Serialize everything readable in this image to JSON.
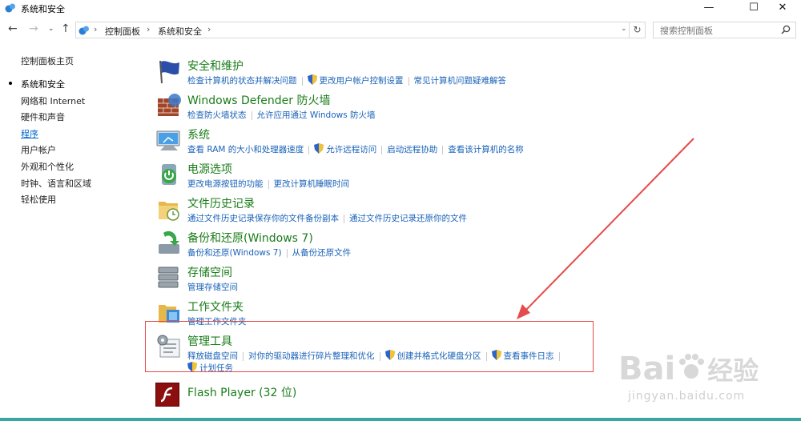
{
  "window": {
    "title": "系统和安全",
    "min": "—",
    "max": "☐",
    "close": "✕"
  },
  "address": {
    "crumbs": [
      "控制面板",
      "系统和安全"
    ],
    "search_placeholder": "搜索控制面板"
  },
  "nav": {
    "items": [
      {
        "label": "控制面板主页"
      },
      {
        "label": "系统和安全"
      },
      {
        "label": "网络和 Internet"
      },
      {
        "label": "硬件和声音"
      },
      {
        "label": "程序"
      },
      {
        "label": "用户帐户"
      },
      {
        "label": "外观和个性化"
      },
      {
        "label": "时钟、语言和区域"
      },
      {
        "label": "轻松使用"
      }
    ]
  },
  "categories": [
    {
      "title": "安全和维护",
      "icon": "flag-icon",
      "links": [
        "检查计算机的状态并解决问题",
        "更改用户帐户控制设置",
        "常见计算机问题疑难解答"
      ]
    },
    {
      "title": "Windows Defender 防火墙",
      "icon": "firewall-icon",
      "links": [
        "检查防火墙状态",
        "允许应用通过 Windows 防火墙"
      ]
    },
    {
      "title": "系统",
      "icon": "system-icon",
      "links": [
        "查看 RAM 的大小和处理器速度",
        "允许远程访问",
        "启动远程协助",
        "查看该计算机的名称"
      ]
    },
    {
      "title": "电源选项",
      "icon": "power-icon",
      "links": [
        "更改电源按钮的功能",
        "更改计算机睡眠时间"
      ]
    },
    {
      "title": "文件历史记录",
      "icon": "file-history-icon",
      "links": [
        "通过文件历史记录保存你的文件备份副本",
        "通过文件历史记录还原你的文件"
      ]
    },
    {
      "title": "备份和还原(Windows 7)",
      "icon": "backup-icon",
      "links": [
        "备份和还原(Windows 7)",
        "从备份还原文件"
      ]
    },
    {
      "title": "存储空间",
      "icon": "storage-icon",
      "links": [
        "管理存储空间"
      ]
    },
    {
      "title": "工作文件夹",
      "icon": "work-folders-icon",
      "links": [
        "管理工作文件夹"
      ]
    },
    {
      "title": "管理工具",
      "icon": "admin-tools-icon",
      "links": [
        "释放磁盘空间",
        "对你的驱动器进行碎片整理和优化",
        "创建并格式化硬盘分区",
        "查看事件日志",
        "计划任务"
      ]
    },
    {
      "title": "Flash Player (32 位)",
      "icon": "flash-icon",
      "links": []
    }
  ],
  "watermark": {
    "brand": "Bai",
    "brand2": "经验",
    "url": "jingyan.baidu.com"
  },
  "colors": {
    "title_green": "#1a7d1a",
    "link_blue": "#1a63b8",
    "annotation_red": "#e64a4a"
  }
}
